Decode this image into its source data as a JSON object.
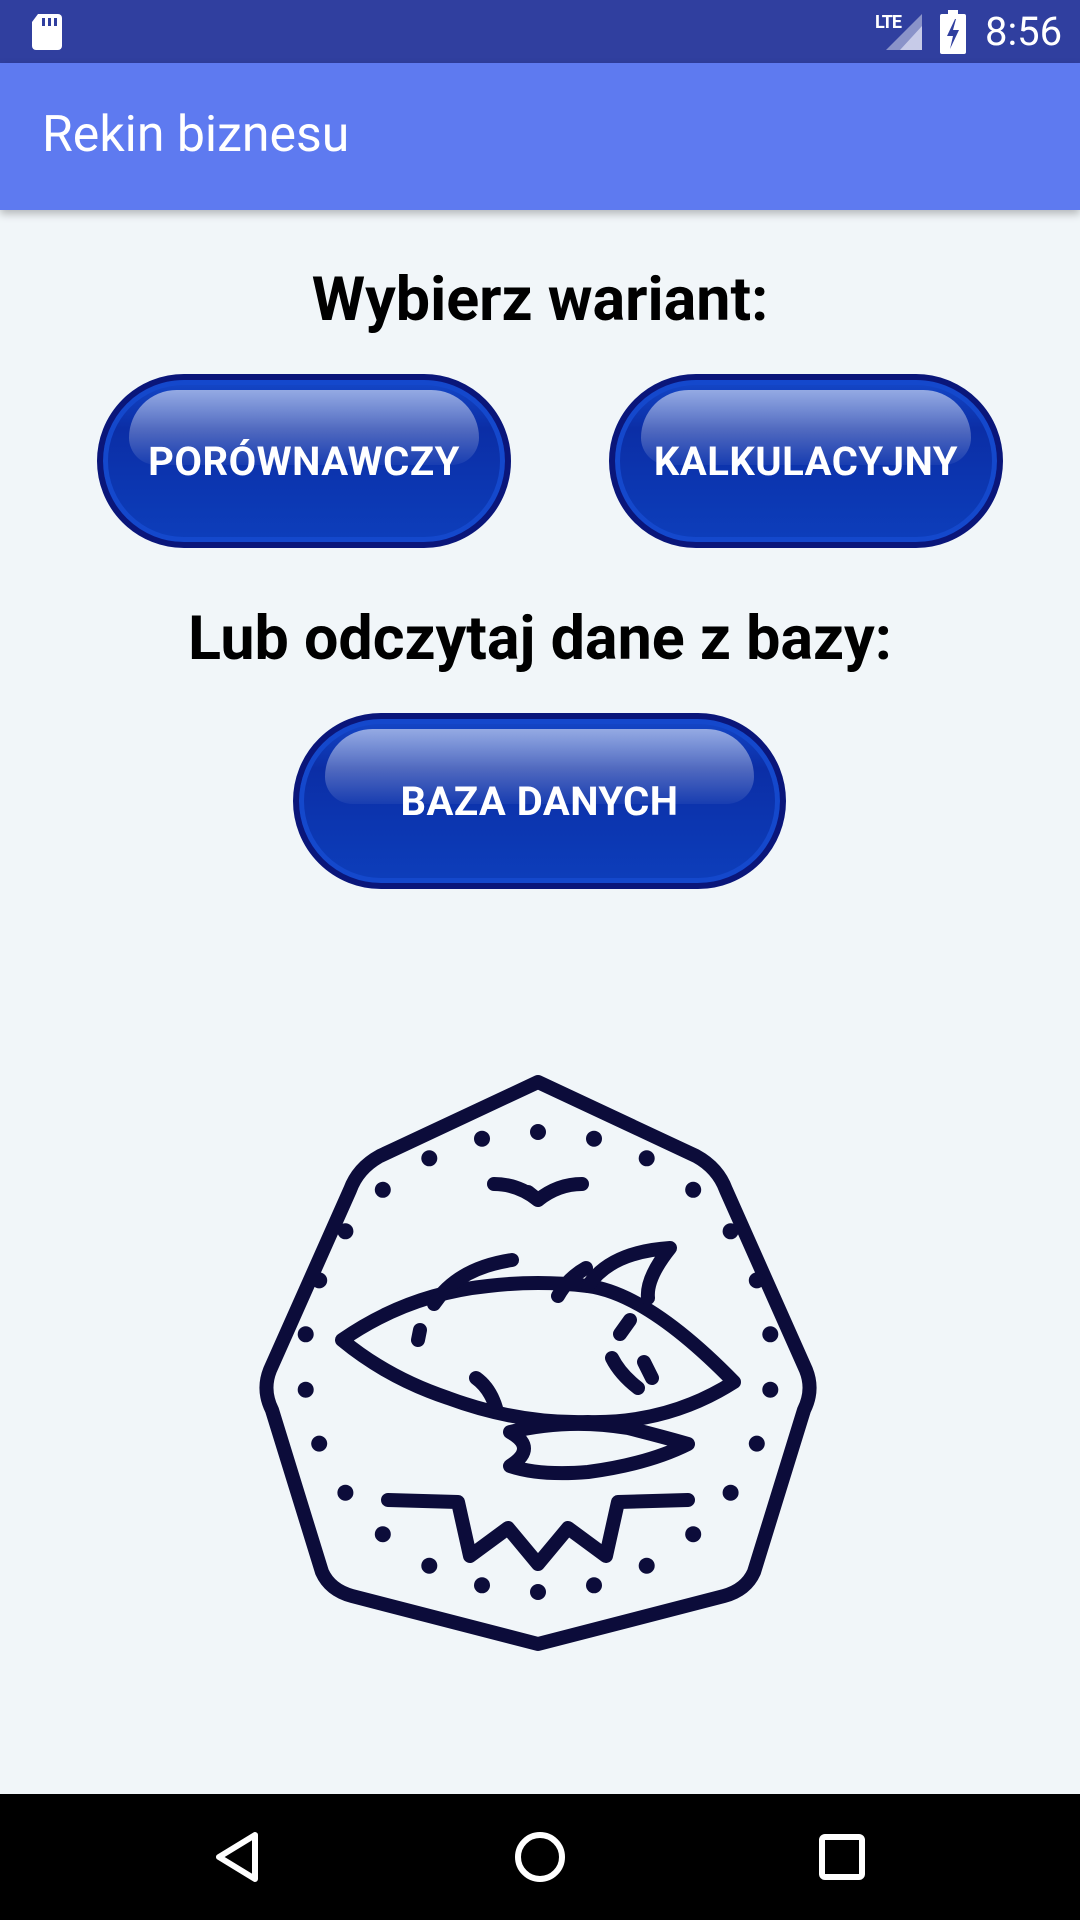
{
  "status_bar": {
    "time": "8:56",
    "network": "LTE",
    "icons": [
      "sd-card-icon",
      "signal-icon",
      "battery-charging-icon"
    ]
  },
  "app_bar": {
    "title": "Rekin biznesu"
  },
  "main": {
    "heading_variant": "Wybierz wariant:",
    "buttons": {
      "porownawczy": "PORÓWNAWCZY",
      "kalkulacyjny": "KALKULACYJNY"
    },
    "heading_database": "Lub odczytaj dane z bazy:",
    "database_button": "BAZA DANYCH",
    "logo_icon": "shark-coin-icon"
  },
  "nav_bar": {
    "icons": [
      "back-icon",
      "home-icon",
      "recents-icon"
    ]
  },
  "colors": {
    "status_bar": "#303f9f",
    "app_bar": "#5e7af0",
    "background": "#f1f6f9",
    "button": "#0d3ebb",
    "logo_stroke": "#0c0c3a"
  }
}
